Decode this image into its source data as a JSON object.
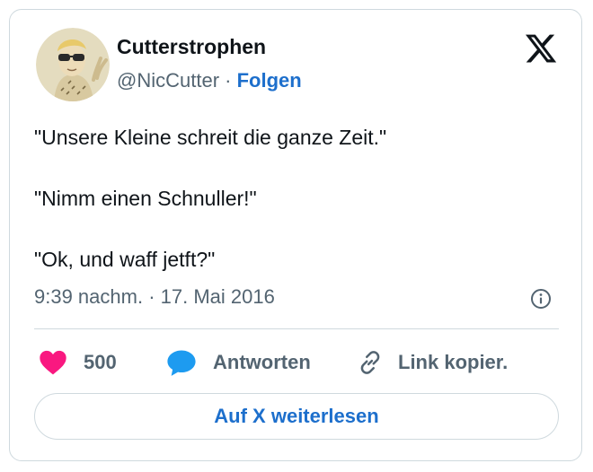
{
  "author": {
    "name": "Cutterstrophen",
    "handle": "@NicCutter",
    "separator": "·",
    "follow_label": "Folgen",
    "avatar_icon": "illustrated-avatar-icon"
  },
  "platform_icon": "x-logo-icon",
  "tweet": {
    "lines": [
      "\"Unsere Kleine schreit die ganze Zeit.\"",
      "\"Nimm einen Schnuller!\"",
      "\"Ok, und waff jetft?\""
    ],
    "timestamp": "9:39 nachm. · 17. Mai 2016"
  },
  "actions": {
    "like": {
      "icon": "heart-icon",
      "count": "500",
      "color": "#f91880"
    },
    "reply": {
      "icon": "speech-bubble-icon",
      "label": "Antworten",
      "color": "#1d9bf0"
    },
    "copy_link": {
      "icon": "link-icon",
      "label": "Link kopier."
    }
  },
  "read_more_label": "Auf X weiterlesen",
  "colors": {
    "text": "#0f1419",
    "secondary_text": "#536471",
    "accent": "#1d6fcc",
    "border": "#cfd9de"
  }
}
